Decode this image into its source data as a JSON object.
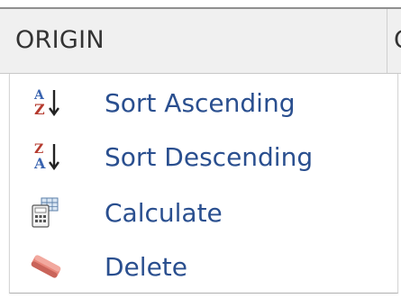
{
  "header": {
    "column_label": "ORIGIN",
    "next_column_label": "C"
  },
  "menu": {
    "items": [
      {
        "label": "Sort Ascending",
        "icon": "sort-ascending-icon"
      },
      {
        "label": "Sort Descending",
        "icon": "sort-descending-icon"
      },
      {
        "label": "Calculate",
        "icon": "calculator-icon"
      },
      {
        "label": "Delete",
        "icon": "eraser-icon"
      }
    ]
  },
  "colors": {
    "menu_text": "#2a4f8f",
    "header_bg": "#f0f0f0",
    "header_text": "#333333"
  }
}
